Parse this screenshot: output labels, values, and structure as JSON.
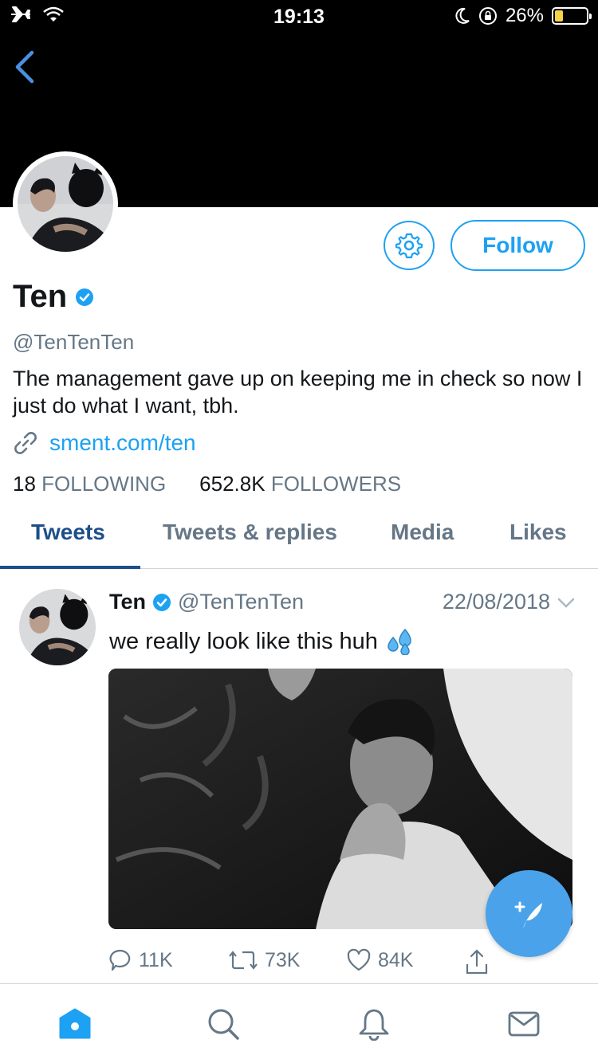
{
  "status_bar": {
    "time": "19:13",
    "battery_percent": "26%"
  },
  "profile": {
    "name": "Ten",
    "handle": "@TenTenTen",
    "bio": "The management gave up on keeping me in check so now I just do what I want, tbh.",
    "link": "sment.com/ten",
    "following_count": "18",
    "following_label": "FOLLOWING",
    "followers_count": "652.8K",
    "followers_label": "FOLLOWERS",
    "follow_button": "Follow"
  },
  "tabs": [
    {
      "label": "Tweets",
      "active": true
    },
    {
      "label": "Tweets & replies"
    },
    {
      "label": "Media"
    },
    {
      "label": "Likes"
    }
  ],
  "tweet": {
    "name": "Ten",
    "handle": "@TenTenTen",
    "date": "22/08/2018",
    "text": "we really look like this huh",
    "replies": "11K",
    "retweets": "73K",
    "likes": "84K"
  },
  "colors": {
    "accent": "#1da1f2",
    "tab_active": "#1c4f8a",
    "muted": "#657786"
  },
  "icons": [
    "airplane-icon",
    "wifi-icon",
    "moon-icon",
    "rotation-lock-icon",
    "battery-icon",
    "back-chevron-icon",
    "gear-icon",
    "verified-icon",
    "link-icon",
    "chevron-down-icon",
    "sweat-drops-icon",
    "reply-icon",
    "retweet-icon",
    "heart-icon",
    "share-icon",
    "compose-icon",
    "home-icon",
    "search-icon",
    "bell-icon",
    "mail-icon"
  ]
}
